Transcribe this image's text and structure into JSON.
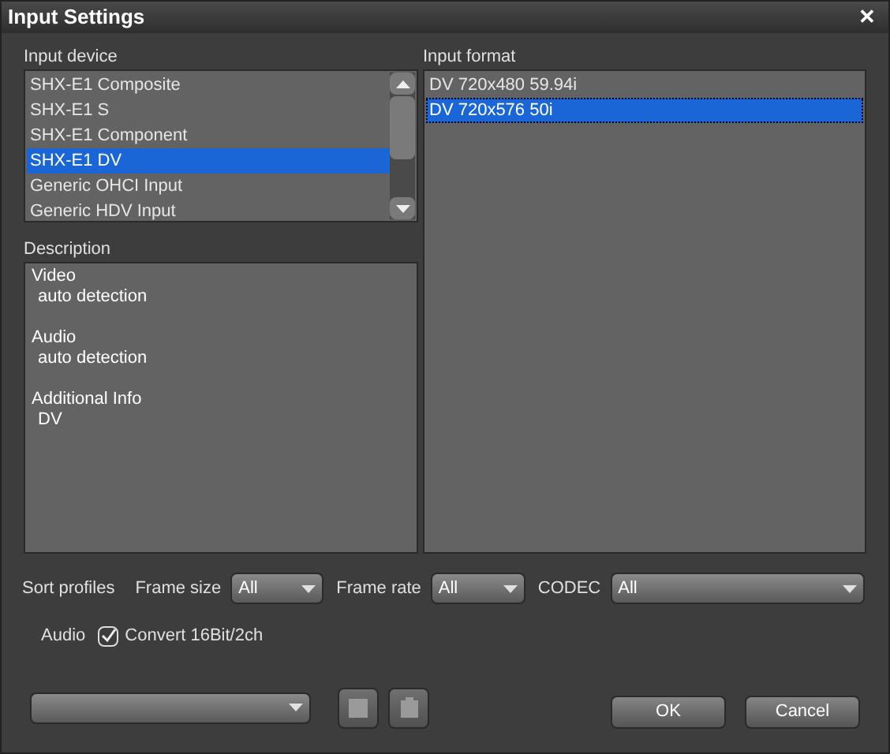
{
  "window": {
    "title": "Input Settings",
    "close": "✕"
  },
  "input_device": {
    "label": "Input device",
    "items": [
      {
        "label": "SHX-E1 Composite",
        "selected": false
      },
      {
        "label": "SHX-E1 S",
        "selected": false
      },
      {
        "label": "SHX-E1 Component",
        "selected": false
      },
      {
        "label": "SHX-E1 DV",
        "selected": true
      },
      {
        "label": "Generic OHCI Input",
        "selected": false
      },
      {
        "label": "Generic HDV Input",
        "selected": false
      }
    ]
  },
  "description": {
    "label": "Description",
    "sections": [
      {
        "heading": "Video",
        "value": "auto detection"
      },
      {
        "heading": "Audio",
        "value": "auto detection"
      },
      {
        "heading": "Additional Info",
        "value": "DV"
      }
    ]
  },
  "input_format": {
    "label": "Input format",
    "items": [
      {
        "label": "DV 720x480 59.94i",
        "selected": false
      },
      {
        "label": "DV 720x576 50i",
        "selected": true
      }
    ]
  },
  "sort": {
    "label": "Sort profiles",
    "filters": [
      {
        "label": "Frame size",
        "value": "All"
      },
      {
        "label": "Frame rate",
        "value": "All"
      },
      {
        "label": "CODEC",
        "value": "All"
      }
    ]
  },
  "audio": {
    "label": "Audio",
    "option": "Convert 16Bit/2ch",
    "checked": true
  },
  "buttons": [
    "OK",
    "Cancel"
  ]
}
